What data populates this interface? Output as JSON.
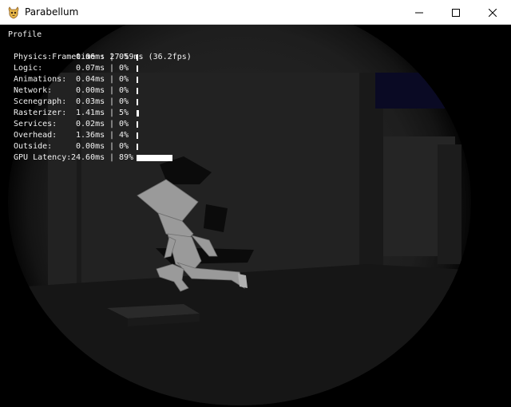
{
  "window": {
    "title": "Parabellum",
    "icon": "parabellum-app-icon",
    "controls": [
      "minimize-icon",
      "maximize-icon",
      "close-icon"
    ]
  },
  "profile": {
    "title": "Profile",
    "frametime": "Frametime : 27.59ms (36.2fps)",
    "rows": [
      {
        "label": "Physics:",
        "ms": "0.06ms",
        "sep": "|",
        "pct": "0%",
        "fraction": 0.0
      },
      {
        "label": "Logic:",
        "ms": "0.07ms",
        "sep": "|",
        "pct": "0%",
        "fraction": 0.0
      },
      {
        "label": "Animations:",
        "ms": "0.04ms",
        "sep": "|",
        "pct": "0%",
        "fraction": 0.0
      },
      {
        "label": "Network:",
        "ms": "0.00ms",
        "sep": "|",
        "pct": "0%",
        "fraction": 0.0
      },
      {
        "label": "Scenegraph:",
        "ms": "0.03ms",
        "sep": "|",
        "pct": "0%",
        "fraction": 0.0
      },
      {
        "label": "Rasterizer:",
        "ms": "1.41ms",
        "sep": "|",
        "pct": "5%",
        "fraction": 0.05
      },
      {
        "label": "Services:",
        "ms": "0.02ms",
        "sep": "|",
        "pct": "0%",
        "fraction": 0.0
      },
      {
        "label": "Overhead:",
        "ms": "1.36ms",
        "sep": "|",
        "pct": "4%",
        "fraction": 0.04
      },
      {
        "label": "Outside:",
        "ms": "0.00ms",
        "sep": "|",
        "pct": "0%",
        "fraction": 0.0
      },
      {
        "label": "GPU Latency:",
        "ms": "24.60ms",
        "sep": "|",
        "pct": "89%",
        "fraction": 0.89
      }
    ]
  },
  "colors": {
    "overlay_text": "#f2f2f2",
    "scene_wall": "#1f1f1f",
    "scene_floor": "#141414",
    "character": "#9a9a9a"
  }
}
